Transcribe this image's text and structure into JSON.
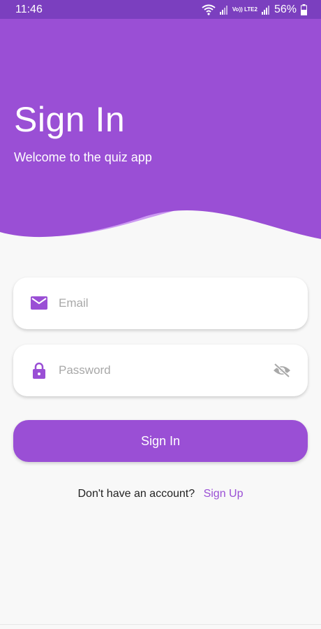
{
  "status_bar": {
    "time": "11:46",
    "network_label": "Vo)) LTE2",
    "battery": "56%"
  },
  "hero": {
    "title": "Sign In",
    "subtitle": "Welcome to the quiz app"
  },
  "form": {
    "email_placeholder": "Email",
    "password_placeholder": "Password",
    "email_icon": "mail-icon",
    "password_icon": "lock-icon",
    "visibility_icon": "eye-off-icon",
    "submit_label": "Sign In"
  },
  "footer": {
    "prompt": "Don't have an account?",
    "link": "Sign Up"
  },
  "colors": {
    "primary": "#9a4fd5",
    "primary_light": "#cc99f2",
    "status_bar": "#7b3fbf",
    "background": "#f8f8f8"
  }
}
